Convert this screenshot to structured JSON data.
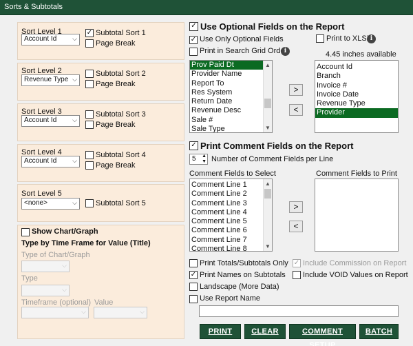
{
  "window": {
    "title": "Sorts & Subtotals"
  },
  "sort_levels": [
    {
      "label": "Sort Level 1",
      "value": "Account Id",
      "subtotal_label": "Subtotal Sort 1",
      "subtotal_checked": true,
      "pagebreak_label": "Page Break",
      "pagebreak_checked": false
    },
    {
      "label": "Sort Level 2",
      "value": "Revenue Type",
      "subtotal_label": "Subtotal Sort 2",
      "subtotal_checked": false,
      "pagebreak_label": "Page Break",
      "pagebreak_checked": false
    },
    {
      "label": "Sort Level 3",
      "value": "Account Id",
      "subtotal_label": "Subtotal Sort 3",
      "subtotal_checked": false,
      "pagebreak_label": "Page Break",
      "pagebreak_checked": false
    },
    {
      "label": "Sort Level 4",
      "value": "Account Id",
      "subtotal_label": "Subtotal Sort 4",
      "subtotal_checked": false,
      "pagebreak_label": "Page Break",
      "pagebreak_checked": false
    },
    {
      "label": "Sort Level 5",
      "value": "<none>",
      "subtotal_label": "Subtotal Sort 5",
      "subtotal_checked": false
    }
  ],
  "chart": {
    "show_label": "Show Chart/Graph",
    "heading": "Type by Time Frame for Value (Title)",
    "type_label": "Type of Chart/Graph",
    "subtype_label": "Type",
    "timeframe_label": "Timeframe (optional)",
    "value_label": "Value"
  },
  "optional_fields": {
    "heading": "Use Optional Fields on the Report",
    "use_only_label": "Use Only Optional Fields",
    "print_xlsx_label": "Print to XLSX",
    "print_grid_order_label": "Print in Search Grid Order",
    "available_text": "4.45 inches available",
    "available_items": [
      "Prov Paid Dt",
      "Provider Name",
      "Report To",
      "Res System",
      "Return Date",
      "Revenue Desc",
      "Sale #",
      "Sale Type"
    ],
    "selected_items": [
      "Account Id",
      "Branch",
      "Invoice #",
      "Invoice Date",
      "Revenue Type",
      "Provider"
    ],
    "add_button": ">",
    "remove_button": "<"
  },
  "comment_fields": {
    "heading": "Print Comment Fields on the Report",
    "count_value": "5",
    "count_label": "Number of Comment Fields per Line",
    "select_label": "Comment Fields to Select",
    "print_label": "Comment Fields to Print",
    "items": [
      "Comment Line 1",
      "Comment Line 2",
      "Comment Line 3",
      "Comment Line 4",
      "Comment Line 5",
      "Comment Line 6",
      "Comment Line 7",
      "Comment Line 8"
    ],
    "add_button": ">",
    "remove_button": "<"
  },
  "options": {
    "print_totals": "Print Totals/Subtotals Only",
    "include_commission": "Include Commission on Report",
    "print_names": "Print Names on Subtotals",
    "include_void": "Include VOID Values on Report",
    "landscape": "Landscape (More Data)",
    "use_report_name": "Use Report Name"
  },
  "buttons": {
    "print": "PRINT",
    "clear": "CLEAR",
    "comment_setup": "COMMENT SETUP",
    "batch": "BATCH"
  },
  "colors": {
    "titlebar": "#1f5237",
    "panel": "#fbecdc",
    "selection": "#0b6a22"
  }
}
